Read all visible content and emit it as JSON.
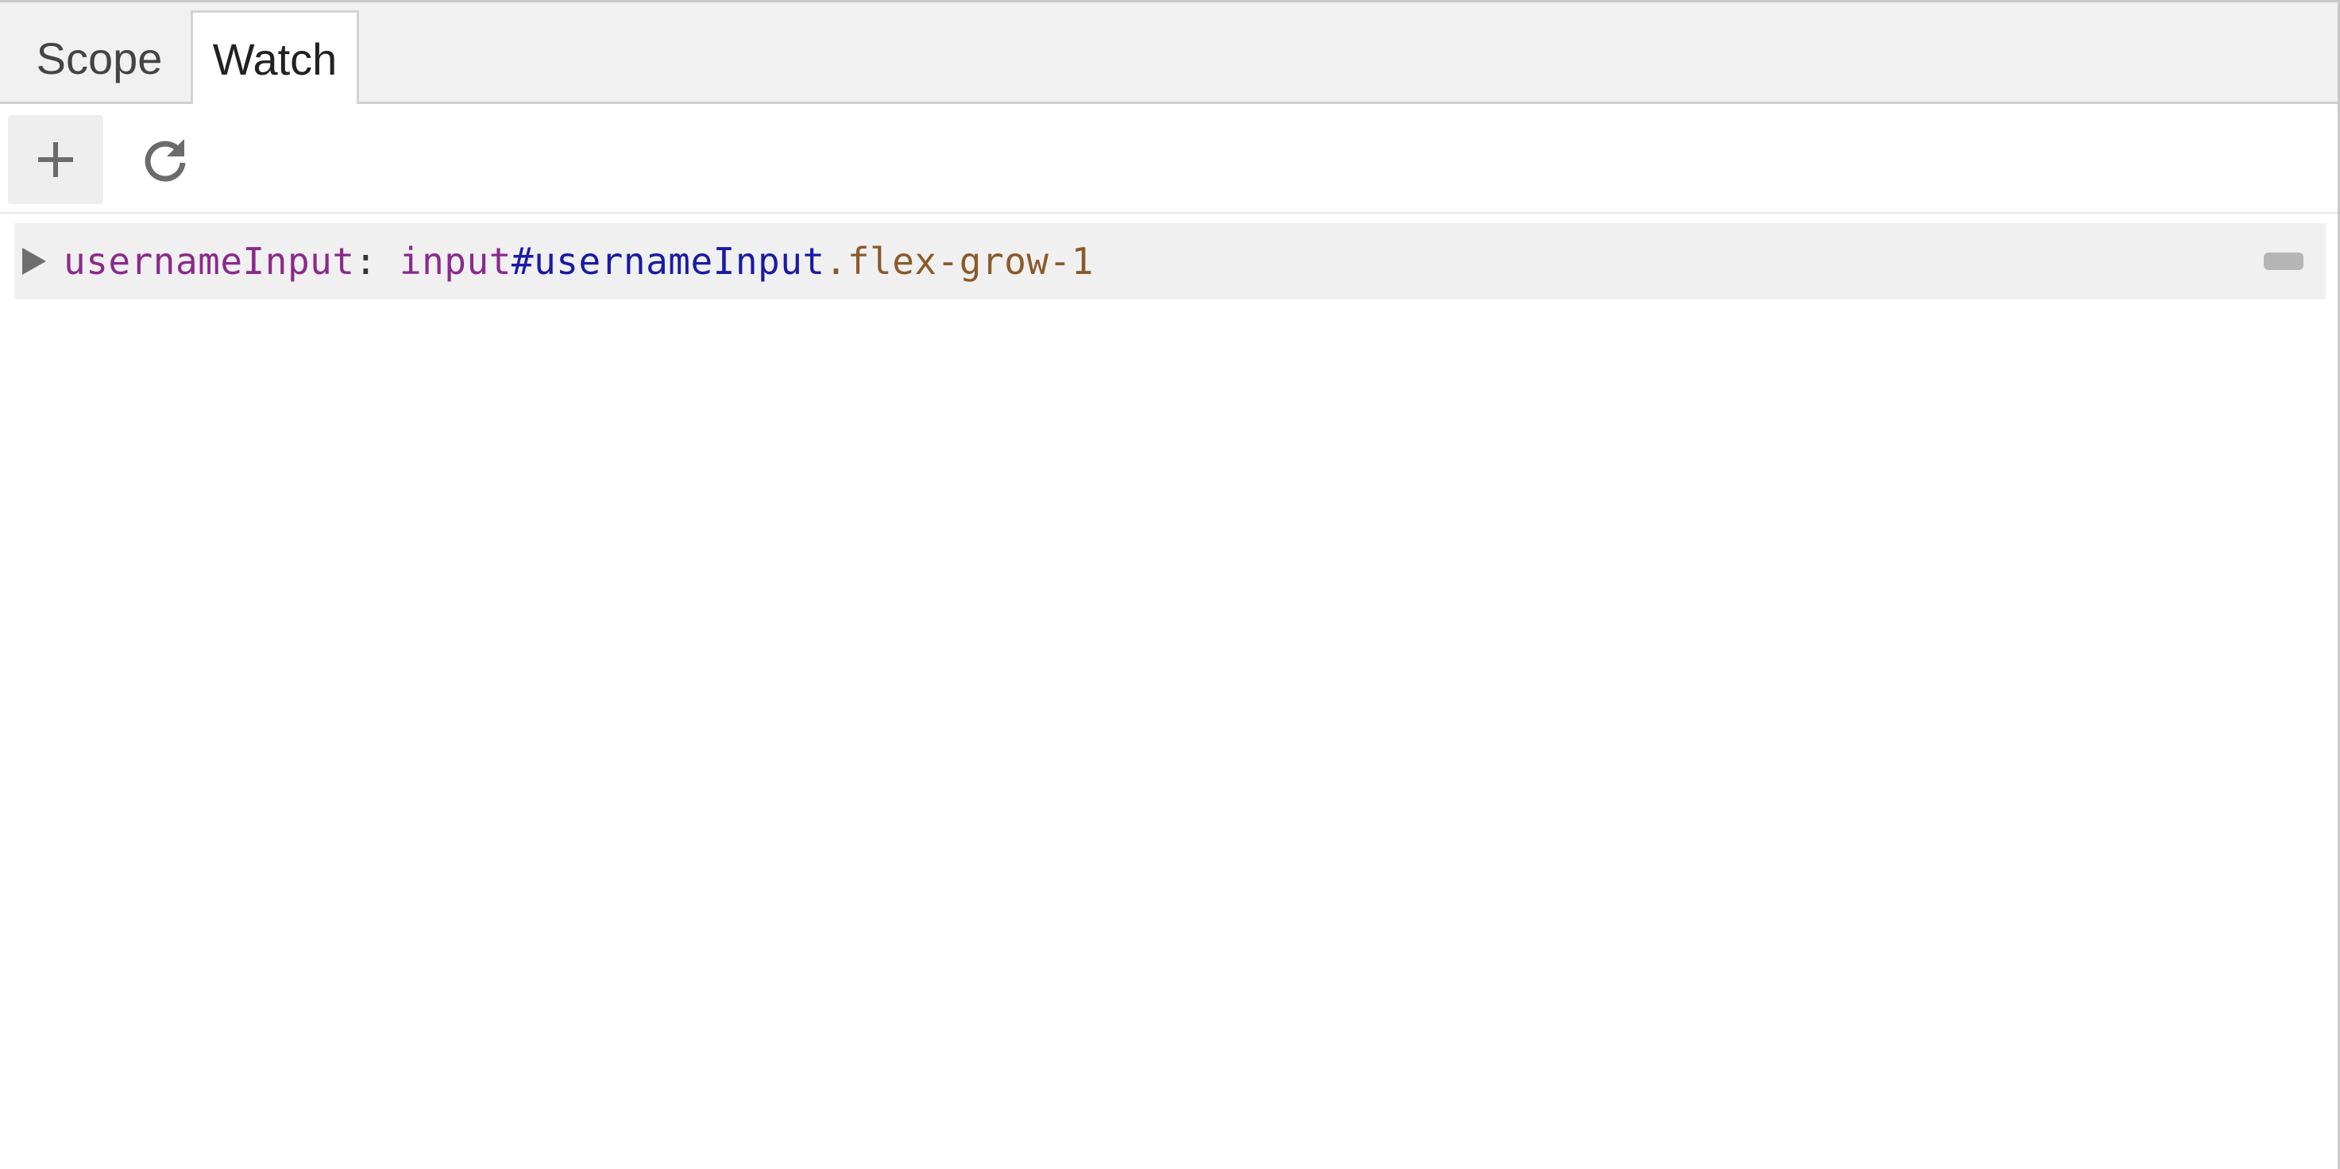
{
  "tabs": [
    {
      "label": "Scope",
      "selected": false
    },
    {
      "label": "Watch",
      "selected": true
    }
  ],
  "toolbar": {
    "add_icon": "plus-icon",
    "refresh_icon": "refresh-icon"
  },
  "watch": {
    "items": [
      {
        "expression": "usernameInput",
        "separator": ": ",
        "value_tag": "input",
        "value_id": "#usernameInput",
        "value_class": ".flex-grow-1",
        "expanded": false
      }
    ]
  },
  "colors": {
    "tab_bar_bg": "#f1f1f1",
    "row_bg": "#f0f0f0",
    "expression": "#8a2a8c",
    "id": "#1a1aa6",
    "class": "#8a5a2a"
  }
}
